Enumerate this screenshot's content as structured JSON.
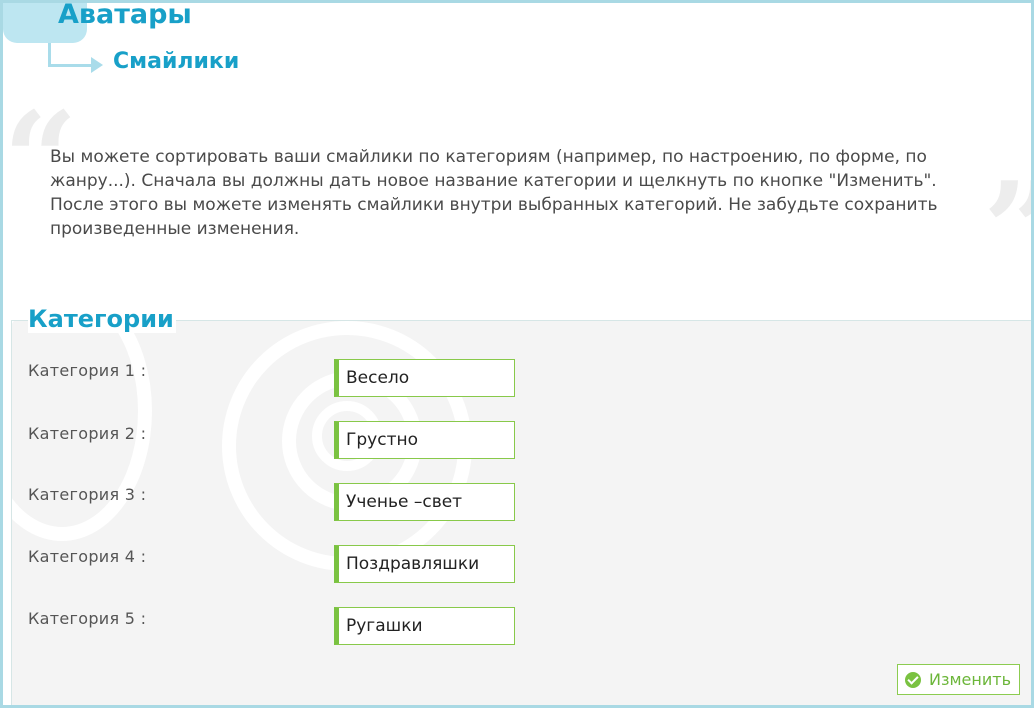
{
  "breadcrumb": {
    "parent": "Аватары",
    "current": "Смайлики"
  },
  "intro_text": "Вы можете сортировать ваши смайлики по категориям (например, по настроению, по форме, по жанру...). Сначала вы должны дать новое название категории и щелкнуть по кнопке \"Изменить\". После этого вы можете изменять смайлики внутри выбранных категорий. Не забудьте сохранить произведенные изменения.",
  "categories_section": {
    "title": "Категории",
    "rows": [
      {
        "label": "Категория 1 :",
        "value": "Весело"
      },
      {
        "label": "Категория 2 :",
        "value": "Грустно"
      },
      {
        "label": "Категория 3 :",
        "value": "Ученье –свет"
      },
      {
        "label": "Категория 4 :",
        "value": "Поздравляшки"
      },
      {
        "label": "Категория 5 :",
        "value": "Ругашки"
      }
    ],
    "submit_label": "Изменить",
    "submit_icon": "check-circle-icon"
  },
  "colors": {
    "accent_blue": "#18a0c8",
    "accent_green": "#7ac241",
    "text": "#4a4a4a"
  }
}
